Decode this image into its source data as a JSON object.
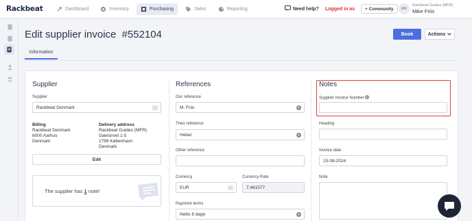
{
  "brand": "Rackbeat",
  "nav": {
    "dashboard": "Dashboard",
    "inventory": "Inventory",
    "purchasing": "Purchasing",
    "sales": "Sales",
    "reporting": "Reporting"
  },
  "topbar": {
    "help": "Need help?",
    "logged_in": "Logged in as",
    "community": "Community",
    "avatar_initials": "MF",
    "org": "Rackbeat Guides (MFR)",
    "user": "Mike Friis"
  },
  "page": {
    "title": "Edit supplier invoice",
    "invoice_no": "#552104",
    "book": "Book",
    "actions": "Actions",
    "tab_information": "Information"
  },
  "supplier": {
    "title": "Supplier",
    "label": "Supplier",
    "value": "Rackbeat Denmark",
    "billing_title": "Billing",
    "billing_lines": [
      "Rackbeat Denmark",
      "8000 Aarhus",
      "Denmark"
    ],
    "delivery_title": "Delivery address",
    "delivery_lines": [
      "Rackbeat Guides (MFR)",
      "Gærtorvet 1-5",
      "1799 København",
      "Denmark"
    ],
    "edit": "Edit",
    "note_prefix": "The supplier has",
    "note_count": "1",
    "note_suffix": "note!"
  },
  "references": {
    "title": "References",
    "our_ref_label": "Our reference",
    "our_ref_value": "M. Friis",
    "their_ref_label": "Their reference",
    "their_ref_value": "Hebel",
    "other_ref_label": "Other reference",
    "other_ref_value": "",
    "currency_label": "Currency",
    "currency_value": "EUR",
    "rate_label": "Currency Rate",
    "rate_value": "7,461577",
    "payment_label": "Payment terms",
    "payment_value": "Netto 8 dage"
  },
  "notes": {
    "title": "Notes",
    "invoice_number_label": "Supplier Invoice Number",
    "invoice_number_value": "",
    "heading_label": "Heading",
    "heading_value": "",
    "invoice_date_label": "Invoice date",
    "invoice_date_value": "15-08-2024",
    "note_label": "Note"
  },
  "colors": {
    "primary": "#4c6fe0",
    "alert": "#e03131",
    "highlight": "#d9413c"
  }
}
